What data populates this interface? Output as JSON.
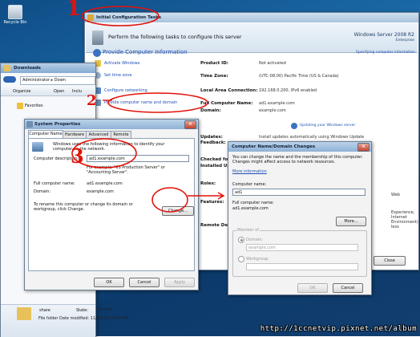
{
  "desktop": {
    "recycle_bin_label": "Recycle Bin"
  },
  "ict": {
    "title": "Initial Configuration Tasks",
    "banner_text": "Perform the following tasks to configure this server",
    "brand_line1": "Windows Server 2008 R2",
    "brand_line2": "Enterprise",
    "section_title": "Provide Computer Information",
    "specify_link": "Specifying computer information",
    "tasks": [
      "Activate Windows",
      "Set time zone",
      "Configure networking",
      "Provide computer name and domain"
    ],
    "props": [
      {
        "name": "Product ID:",
        "value": "Not activated"
      },
      {
        "name": "Time Zone:",
        "value": "(UTC-08:00) Pacific Time (US & Canada)"
      },
      {
        "name": "Local Area Connection:",
        "value": "192.168.0.200, IPv6 enabled"
      },
      {
        "name": "Full Computer Name:",
        "value": "ad1.example.com"
      },
      {
        "name": "Domain:",
        "value": "example.com"
      }
    ],
    "update_link": "Updating your Windows server",
    "updates_label": "Updates:",
    "updates_value": "Install updates automatically using Windows Update",
    "feedback_label": "Feedback:",
    "checked_label": "Checked fo",
    "installed_label": "Installed Up",
    "roles_label": "Roles:",
    "features_label": "Features:",
    "remote_label": "Remote De",
    "right_frag_1": "Web",
    "right_frag_2": "Experience,",
    "right_frag_3": "Internet",
    "right_frag_4": "Environment)",
    "right_frag_5": "less",
    "close_label": "Close"
  },
  "explorer": {
    "title": "Downloads",
    "crumb": "Administrator",
    "crumb2": "Down",
    "organize_label": "Organize",
    "open_label": "Open",
    "include_label": "Inclu",
    "favorites_label": "Favorites",
    "file_name": "share",
    "file_state_label": "State:",
    "file_state_value": "Shared",
    "file_meta": "File folder  Date modified: 11/2/2010 4:50 PM"
  },
  "sysprop": {
    "title": "System Properties",
    "tabs": [
      "Computer Name",
      "Hardware",
      "Advanced",
      "Remote"
    ],
    "intro": "Windows uses the following information to identify your computer on the network.",
    "desc_label": "Computer description:",
    "desc_value": "ad1.example.com",
    "example_text": "For example: \"IIS Production Server\" or \"Accounting Server\".",
    "full_name_label": "Full computer name:",
    "full_name_value": "ad1.example.com",
    "domain_label": "Domain:",
    "domain_value": "example.com",
    "rename_text": "To rename this computer or change its domain or workgroup, click Change.",
    "change_label": "Change...",
    "ok_label": "OK",
    "cancel_label": "Cancel",
    "apply_label": "Apply"
  },
  "cndc": {
    "title": "Computer Name/Domain Changes",
    "intro": "You can change the name and the membership of this computer. Changes might affect access to network resources.",
    "more_info": "More information",
    "name_label": "Computer name:",
    "name_value": "ad1",
    "full_label": "Full computer name:",
    "full_value": "ad1.example.com",
    "more_label": "More...",
    "member_label": "Member of",
    "domain_radio": "Domain:",
    "domain_value": "example.com",
    "workgroup_radio": "Workgroup:",
    "ok_label": "OK",
    "cancel_label": "Cancel"
  },
  "annotations": {
    "step1": "1",
    "step2": "2",
    "step3": "3",
    "color": "#e3120b"
  },
  "watermark": "http://1ccnetvip.pixnet.net/album"
}
